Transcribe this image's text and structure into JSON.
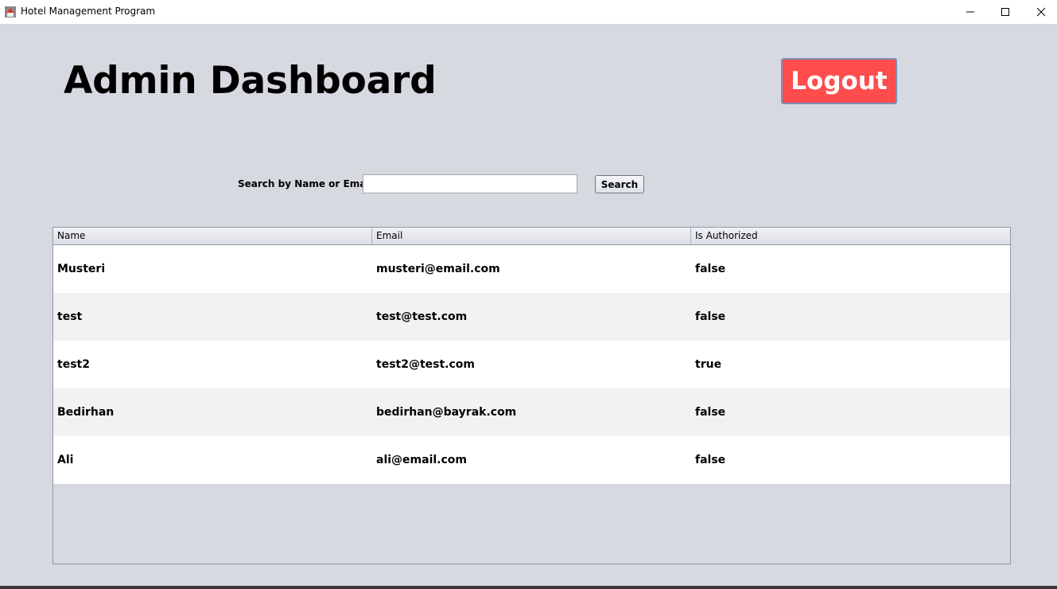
{
  "window": {
    "title": "Hotel Management Program",
    "minimize_label": "–",
    "maximize_label": "☐",
    "close_label": "✕"
  },
  "header": {
    "title": "Admin Dashboard",
    "logout_label": "Logout",
    "logout_color": "#ff4d4d"
  },
  "search": {
    "label": "Search by Name or Email",
    "value": "",
    "placeholder": "",
    "button_label": "Search"
  },
  "table": {
    "columns": [
      "Name",
      "Email",
      "Is Authorized"
    ],
    "rows": [
      [
        "Musteri",
        "musteri@email.com",
        "false"
      ],
      [
        "test",
        "test@test.com",
        "false"
      ],
      [
        "test2",
        "test2@test.com",
        "true"
      ],
      [
        "Bedirhan",
        "bedirhan@bayrak.com",
        "false"
      ],
      [
        "Ali",
        "ali@email.com",
        "false"
      ]
    ]
  }
}
